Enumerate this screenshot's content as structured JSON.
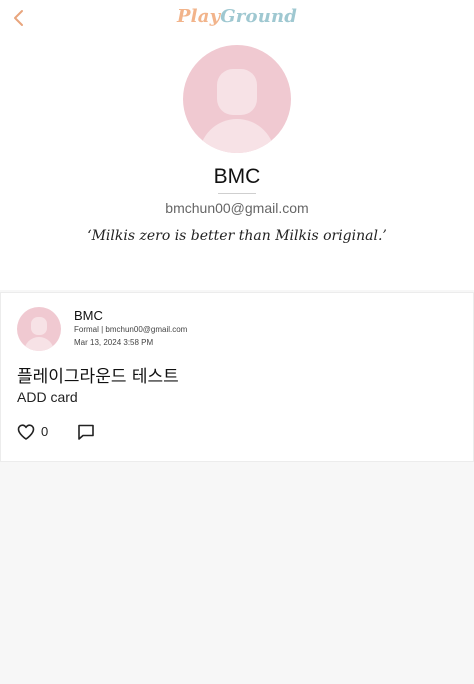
{
  "header": {
    "back_icon": "chevron-left-icon",
    "logo_part1": "Play",
    "logo_part2": "Ground"
  },
  "profile": {
    "name": "BMC",
    "email": "bmchun00@gmail.com",
    "quote": "‘Milkis zero is better than Milkis original.’"
  },
  "post": {
    "author": "BMC",
    "meta": "Formal | bmchun00@gmail.com",
    "date": "Mar 13, 2024 3:58 PM",
    "title": "플레이그라운드 테스트",
    "body": "ADD card",
    "like_count": "0",
    "like_icon": "heart-icon",
    "comment_icon": "comment-icon"
  },
  "colors": {
    "accent_orange": "#e8a57d",
    "logo_blue": "#9fc8d1",
    "avatar_pink": "#f0c9d1"
  }
}
